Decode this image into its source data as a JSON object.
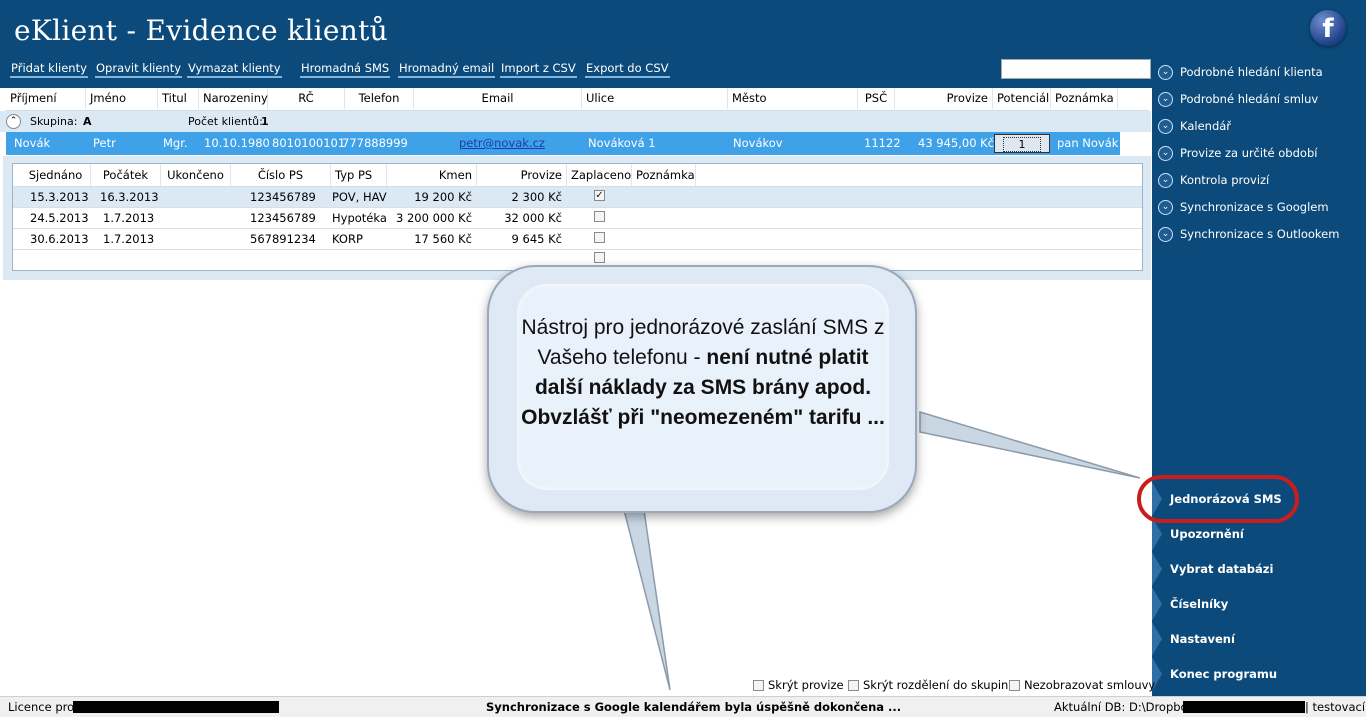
{
  "app": {
    "title": "eKlient - Evidence klientů"
  },
  "toolbar": [
    "Přidat klienty",
    "Opravit klienty",
    "Vymazat klienty",
    "Hromadná SMS",
    "Hromadný email",
    "Import z CSV",
    "Export do CSV"
  ],
  "facebook_icon": "f",
  "side_links": [
    "Podrobné hledání klienta",
    "Podrobné hledání smluv",
    "Kalendář",
    "Provize za určité období",
    "Kontrola provizí",
    "Synchronizace s Googlem",
    "Synchronizace s Outlookem"
  ],
  "side_buttons": [
    "Jednorázová SMS",
    "Upozornění",
    "Vybrat databázi",
    "Číselníky",
    "Nastavení",
    "Konec programu"
  ],
  "clients_columns": [
    "Příjmení",
    "Jméno",
    "Titul",
    "Narozeniny",
    "RČ",
    "Telefon",
    "Email",
    "Ulice",
    "Město",
    "PSČ",
    "Provize",
    "Potenciál",
    "Poznámka"
  ],
  "group": {
    "label": "Skupina:",
    "value": "A",
    "count_label": "Počet klientů:",
    "count": "1"
  },
  "client": {
    "surname": "Novák",
    "name": "Petr",
    "title": "Mgr.",
    "birthday": "10.10.1980",
    "rc": "8010100101",
    "phone": "777888999",
    "email": "petr@novak.cz",
    "street": "Nováková 1",
    "city": "Novákov",
    "zip": "11122",
    "commission": "43 945,00 Kč",
    "potential": "1",
    "note": "pan Novák"
  },
  "contracts_columns": [
    "Sjednáno",
    "Počátek",
    "Ukončeno",
    "Číslo PS",
    "Typ PS",
    "Kmen",
    "Provize",
    "Zaplaceno",
    "Poznámka"
  ],
  "contracts": [
    {
      "agreed": "15.3.2013",
      "start": "16.3.2013",
      "ended": "",
      "number": "123456789",
      "type": "POV, HAV",
      "base": "19 200 Kč",
      "commission": "2 300 Kč",
      "paid": true,
      "note": ""
    },
    {
      "agreed": "24.5.2013",
      "start": "1.7.2013",
      "ended": "",
      "number": "123456789",
      "type": "Hypotéka",
      "base": "3 200 000 Kč",
      "commission": "32 000 Kč",
      "paid": false,
      "note": ""
    },
    {
      "agreed": "30.6.2013",
      "start": "1.7.2013",
      "ended": "",
      "number": "567891234",
      "type": "KORP",
      "base": "17 560 Kč",
      "commission": "9 645 Kč",
      "paid": false,
      "note": ""
    }
  ],
  "callout": {
    "text_normal": "Nástroj pro jednorázové zaslání SMS z Vašeho telefonu - ",
    "text_bold": "není nutné platit další náklady za SMS brány apod. Obvzlášť při \"neomezeném\" tarifu ..."
  },
  "options": [
    "Skrýt provize",
    "Skrýt rozdělení do skupin",
    "Nezobrazovat smlouvy"
  ],
  "status": {
    "licence_label": "Licence pro:",
    "message": "Synchronizace s Google kalendářem byla úspěšně dokončena ...",
    "db_label": "Aktuální DB: D:\\Dropbox",
    "db_suffix": "| testovací"
  },
  "colors": {
    "header": "#0b4a7a",
    "selected_row": "#3fa2e8",
    "group_row": "#dbe9f5",
    "highlight": "#c81e1e"
  }
}
